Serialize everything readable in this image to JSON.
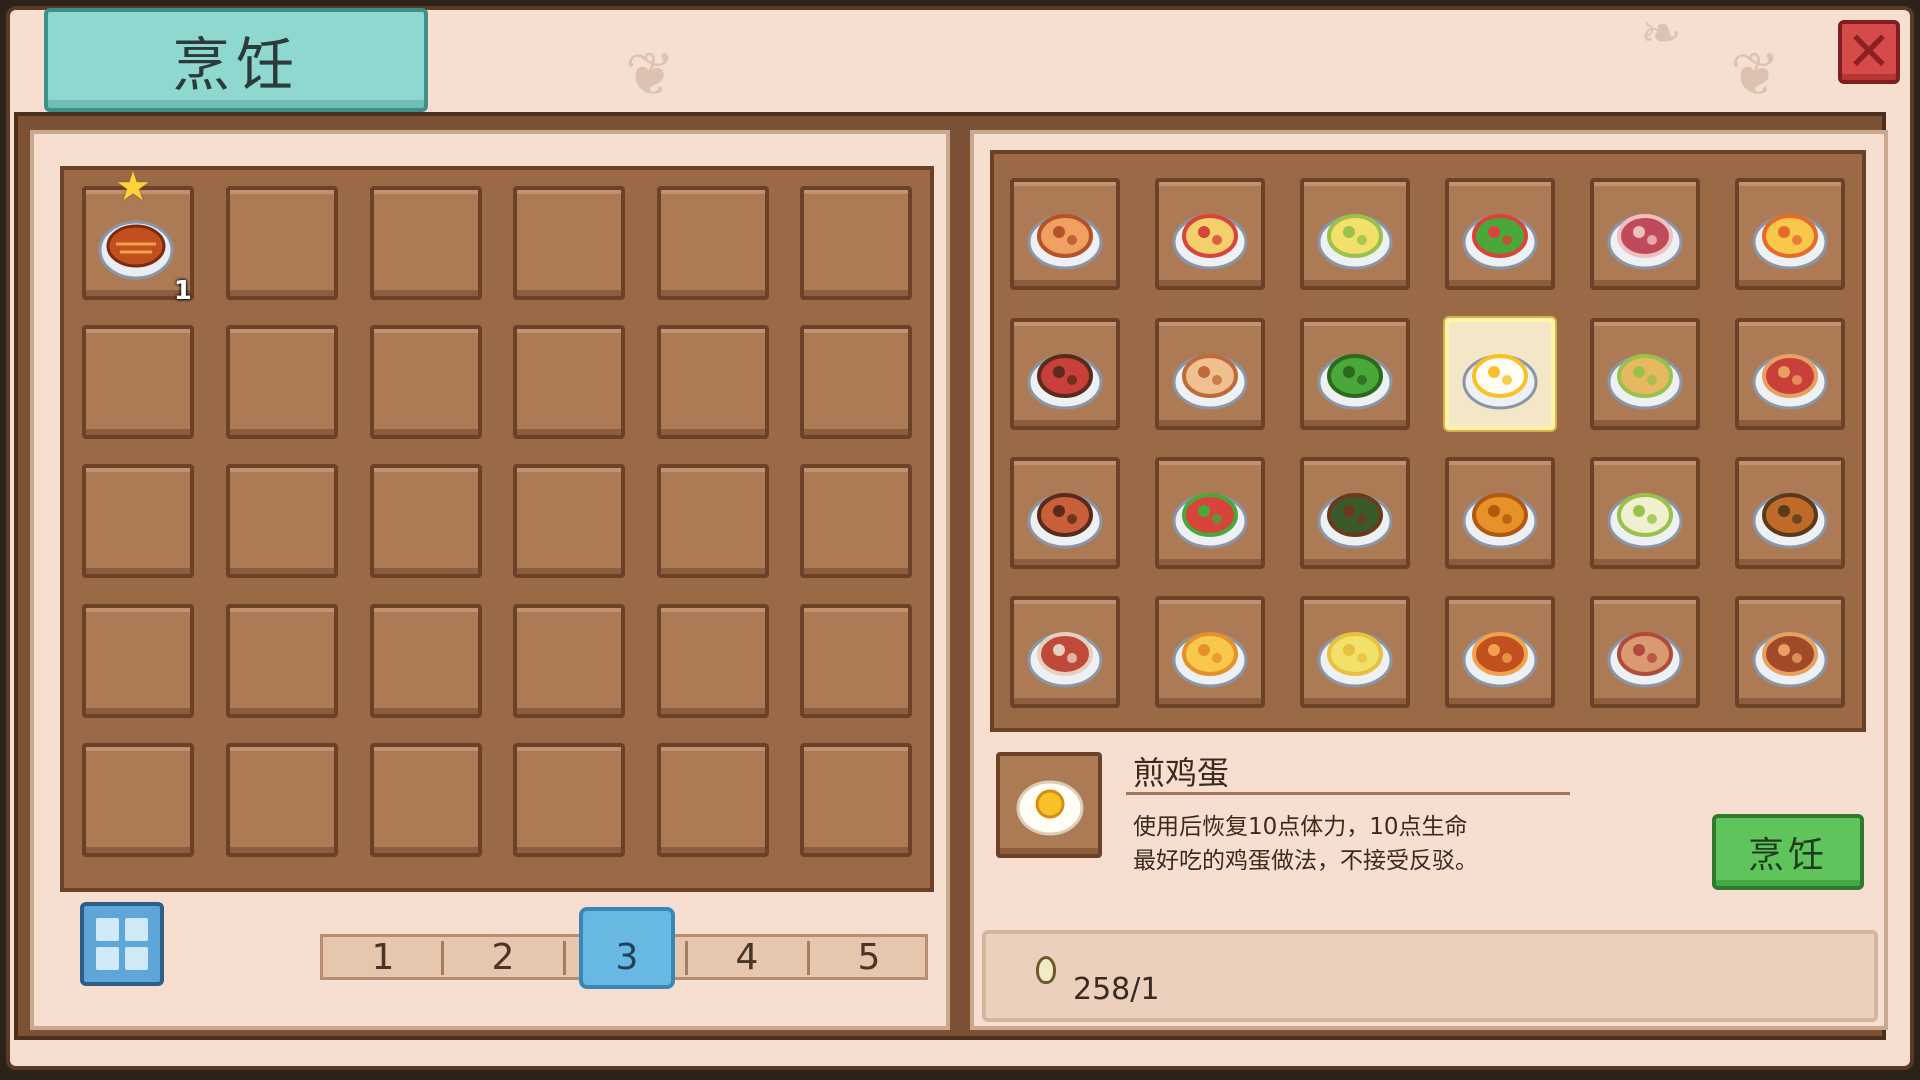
{
  "window": {
    "title": "烹饪",
    "close_icon": "close-icon"
  },
  "inventory": {
    "slots": [
      {
        "item": "fried-fish-dish-icon",
        "quantity": "1",
        "starred": true
      }
    ],
    "pager": {
      "pages": [
        "1",
        "2",
        "3",
        "4",
        "5"
      ],
      "active": "3"
    },
    "bag_button_icon": "grid-bag-icon"
  },
  "recipes": {
    "items": [
      "toast-icon",
      "omelette-salad-icon",
      "fried-rice-icon",
      "vegetable-salad-icon",
      "cake-slice-icon",
      "egg-soup-icon",
      "steak-plate-icon",
      "porridge-icon",
      "green-vegetables-icon",
      "fried-egg-icon",
      "meatball-plate-icon",
      "tomato-dish-icon",
      "stew-bowl-icon",
      "vegetable-soup-icon",
      "pickle-jar-icon",
      "fried-chicken-icon",
      "cucumber-salad-icon",
      "noodle-bowl-icon",
      "roast-meat-icon",
      "corn-soup-icon",
      "corn-plate-icon",
      "fried-fish-icon",
      "sausage-icon",
      "braised-pork-icon"
    ],
    "selected_index": 9
  },
  "detail": {
    "name": "煎鸡蛋",
    "description_line1": "使用后恢复10点体力，10点生命",
    "description_line2": "最好吃的鸡蛋做法，不接受反驳。",
    "cook_button": "烹饪",
    "icon": "fried-egg-icon"
  },
  "cost": {
    "icon": "egg-icon",
    "text": "258/1"
  },
  "colors": {
    "panel_bg": "#f6dfd0",
    "slot_bg": "#ac7a55",
    "title_tab": "#8fd8d0",
    "cook_button": "#5ec45b",
    "active_page": "#67b8e3",
    "close_button": "#d64a4a"
  }
}
